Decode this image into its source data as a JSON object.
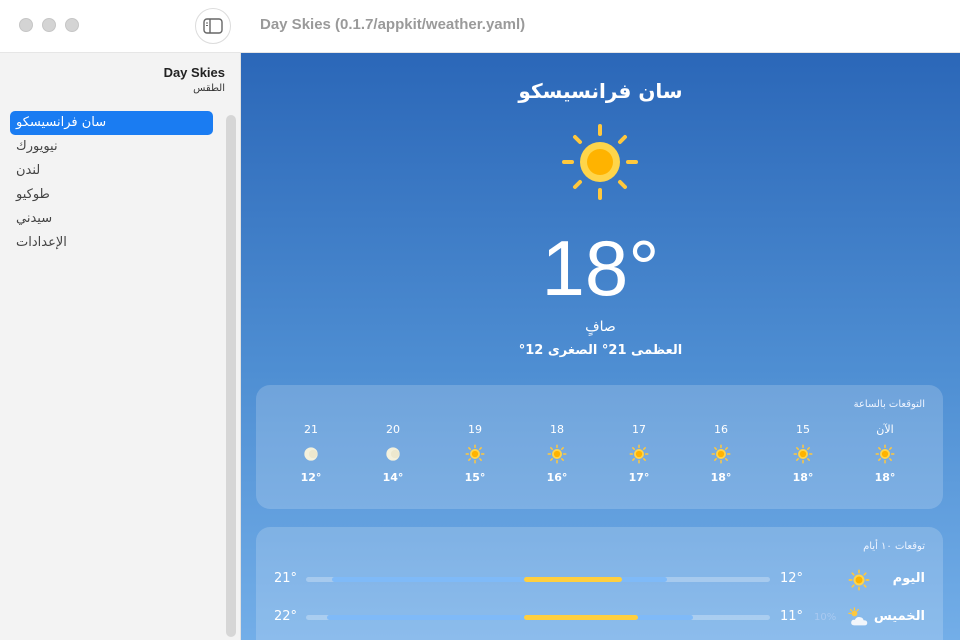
{
  "window": {
    "title": "Day Skies (0.1.7/appkit/weather.yaml)"
  },
  "sidebar": {
    "app_name": "Day Skies",
    "app_subtitle": "الطقس",
    "items": [
      {
        "label": "سان فرانسيسكو",
        "active": true
      },
      {
        "label": "نيويورك",
        "active": false
      },
      {
        "label": "لندن",
        "active": false
      },
      {
        "label": "طوكيو",
        "active": false
      },
      {
        "label": "سيدني",
        "active": false
      },
      {
        "label": "الإعدادات",
        "active": false
      }
    ]
  },
  "current": {
    "city": "سان فرانسيسكو",
    "icon": "sun-icon",
    "temperature": "18°",
    "condition": "صافٍ",
    "high_low": "العظمى 21° الصغرى 12°"
  },
  "hourly": {
    "title": "التوقعات بالساعة",
    "hours": [
      {
        "label": "21",
        "icon": "moon-icon",
        "temp": "12°"
      },
      {
        "label": "20",
        "icon": "moon-icon",
        "temp": "14°"
      },
      {
        "label": "19",
        "icon": "sun-icon",
        "temp": "15°"
      },
      {
        "label": "18",
        "icon": "sun-icon",
        "temp": "16°"
      },
      {
        "label": "17",
        "icon": "sun-icon",
        "temp": "17°"
      },
      {
        "label": "16",
        "icon": "sun-icon",
        "temp": "18°"
      },
      {
        "label": "15",
        "icon": "sun-icon",
        "temp": "18°"
      },
      {
        "label": "الآن",
        "icon": "sun-icon",
        "temp": "18°"
      }
    ]
  },
  "daily": {
    "title": "توقعات ١٠ أيام",
    "range": [
      8,
      26
    ],
    "days": [
      {
        "day": "اليوم",
        "icon": "sun-icon",
        "precip": "",
        "low": "12°",
        "high": "21°",
        "low_value": 12,
        "high_value": 21
      },
      {
        "day": "الخميس",
        "icon": "partly-cloudy-icon",
        "precip": "10%",
        "low": "11°",
        "high": "22°",
        "low_value": 11,
        "high_value": 22
      }
    ]
  },
  "colors": {
    "accent": "#1a7cf2",
    "sun": "#ffc83d",
    "sun_core": "#ffb300",
    "bar_cool": "#7fbaf8",
    "bar_warm": "#ffcf3f"
  }
}
